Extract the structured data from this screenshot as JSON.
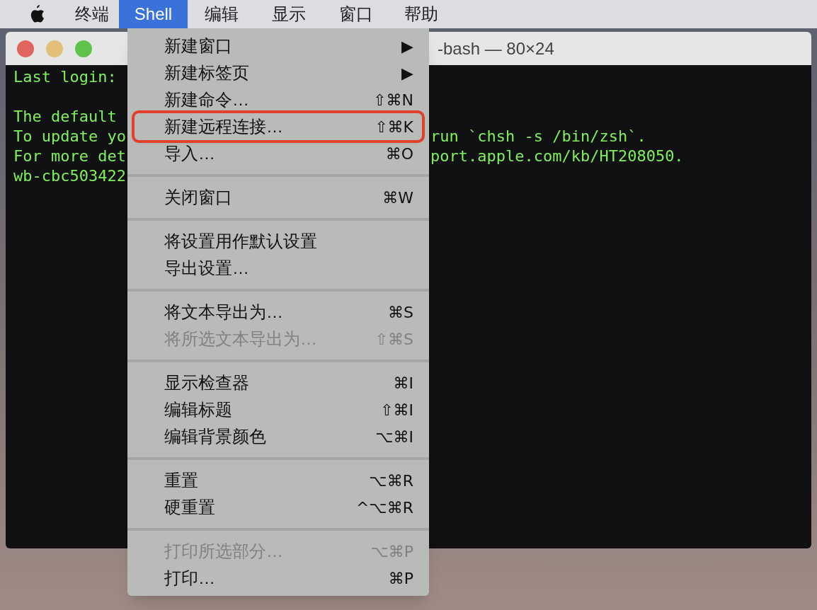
{
  "menu_bar": {
    "items": [
      {
        "label": "终端",
        "selected": false
      },
      {
        "label": "Shell",
        "selected": true
      },
      {
        "label": "编辑",
        "selected": false
      },
      {
        "label": "显示",
        "selected": false
      },
      {
        "label": "窗口",
        "selected": false
      },
      {
        "label": "帮助",
        "selected": false
      }
    ]
  },
  "terminal": {
    "title": "-bash — 80×24",
    "lines": [
      {
        "kind": "text",
        "left": "Last login: "
      },
      {
        "kind": "blank"
      },
      {
        "kind": "text",
        "left": "The default "
      },
      {
        "kind": "text",
        "left": "To update yo",
        "right": "run `chsh -s /bin/zsh`."
      },
      {
        "kind": "text",
        "left": "For more det",
        "right": "port.apple.com/kb/HT208050."
      },
      {
        "kind": "text",
        "left": "wb-cbc503422"
      }
    ]
  },
  "shell_menu": {
    "sections": [
      [
        {
          "label": "新建窗口",
          "shortcut": "▶",
          "disabled": false,
          "highlighted": false
        },
        {
          "label": "新建标签页",
          "shortcut": "▶",
          "disabled": false,
          "highlighted": false
        },
        {
          "label": "新建命令…",
          "shortcut": "⇧⌘N",
          "disabled": false,
          "highlighted": false
        },
        {
          "label": "新建远程连接…",
          "shortcut": "⇧⌘K",
          "disabled": false,
          "highlighted": true
        },
        {
          "label": "导入…",
          "shortcut": "⌘O",
          "disabled": false,
          "highlighted": false
        }
      ],
      [
        {
          "label": "关闭窗口",
          "shortcut": "⌘W",
          "disabled": false,
          "highlighted": false
        }
      ],
      [
        {
          "label": "将设置用作默认设置",
          "disabled": false,
          "highlighted": false
        },
        {
          "label": "导出设置…",
          "disabled": false,
          "highlighted": false
        }
      ],
      [
        {
          "label": "将文本导出为…",
          "shortcut": "⌘S",
          "disabled": false,
          "highlighted": false
        },
        {
          "label": "将所选文本导出为…",
          "shortcut": "⇧⌘S",
          "disabled": true,
          "highlighted": false
        }
      ],
      [
        {
          "label": "显示检查器",
          "shortcut": "⌘I",
          "disabled": false,
          "highlighted": false
        },
        {
          "label": "编辑标题",
          "shortcut": "⇧⌘I",
          "disabled": false,
          "highlighted": false
        },
        {
          "label": "编辑背景颜色",
          "shortcut": "⌥⌘I",
          "disabled": false,
          "highlighted": false
        }
      ],
      [
        {
          "label": "重置",
          "shortcut": "⌥⌘R",
          "disabled": false,
          "highlighted": false
        },
        {
          "label": "硬重置",
          "shortcut": "^⌥⌘R",
          "disabled": false,
          "highlighted": false
        }
      ],
      [
        {
          "label": "打印所选部分…",
          "shortcut": "⌥⌘P",
          "disabled": true,
          "highlighted": false
        },
        {
          "label": "打印…",
          "shortcut": "⌘P",
          "disabled": false,
          "highlighted": false
        }
      ]
    ]
  }
}
